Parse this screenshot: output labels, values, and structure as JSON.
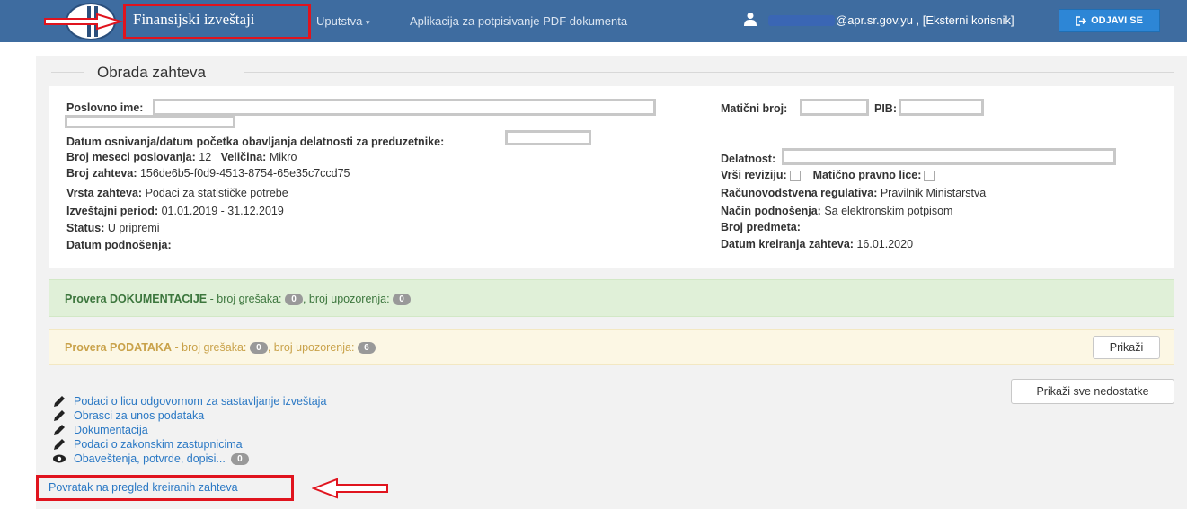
{
  "navbar": {
    "brand": "Finansijski izveštaji",
    "menu_uputstva": "Uputstva",
    "menu_aplikacija": "Aplikacija za potpisivanje PDF dokumenta",
    "user_text": "@apr.sr.gov.yu , [Eksterni korisnik]",
    "logout_label": "ODJAVI SE",
    "bg_color": "#3e6ca0",
    "logout_color": "#2d86d6"
  },
  "page": {
    "section_title": "Obrada zahteva"
  },
  "info": {
    "poslovno_ime_label": "Poslovno ime:",
    "maticni_broj_label": "Matični broj:",
    "pib_label": "PIB:",
    "datum_osnivanja_label": "Datum osnivanja/datum početka obavljanja delatnosti za preduzetnike:",
    "broj_meseci_label": "Broj meseci poslovanja:",
    "broj_meseci_value": "12",
    "velicina_label": "Veličina:",
    "velicina_value": "Mikro",
    "delatnost_label": "Delatnost:",
    "broj_zahteva_label": "Broj zahteva:",
    "broj_zahteva_value": "156de6b5-f0d9-4513-8754-65e35c7ccd75",
    "vrsi_reviziju_label": "Vrši reviziju:",
    "maticno_pravno_lice_label": "Matično pravno lice:",
    "vrsta_zahteva_label": "Vrsta zahteva:",
    "vrsta_zahteva_value": "Podaci za statističke potrebe",
    "racunovodstvena_label": "Računovodstvena regulativa:",
    "racunovodstvena_value": "Pravilnik Ministarstva",
    "izvestajni_period_label": "Izveštajni period:",
    "izvestajni_period_value": "01.01.2019 - 31.12.2019",
    "nacin_podnosenja_label": "Način podnošenja:",
    "nacin_podnosenja_value": "Sa elektronskim potpisom",
    "status_label": "Status:",
    "status_value": "U pripremi",
    "broj_predmeta_label": "Broj predmeta:",
    "datum_podnosenja_label": "Datum podnošenja:",
    "datum_kreiranja_label": "Datum kreiranja zahteva:",
    "datum_kreiranja_value": "16.01.2020"
  },
  "alerts": {
    "dokumentacija": {
      "title": "Provera DOKUMENTACIJE",
      "errors_text": " - broj grešaka: ",
      "errors_count": "0",
      "warnings_text": ", broj upozorenja: ",
      "warnings_count": "0",
      "color": "#3c763d"
    },
    "podataka": {
      "title": "Provera PODATAKA",
      "errors_text": " - broj grešaka: ",
      "errors_count": "0",
      "warnings_text": ", broj upozorenja: ",
      "warnings_count": "6",
      "color": "#c9a24a",
      "button_label": "Prikaži"
    }
  },
  "actions": {
    "show_all_label": "Prikaži sve nedostatke"
  },
  "links": [
    {
      "label": "Podaci o licu odgovornom za sastavljanje izveštaja",
      "icon": "pencil-icon"
    },
    {
      "label": "Obrasci za unos podataka",
      "icon": "pencil-icon"
    },
    {
      "label": "Dokumentacija",
      "icon": "pencil-icon"
    },
    {
      "label": "Podaci o zakonskim zastupnicima",
      "icon": "pencil-icon"
    },
    {
      "label": "Obaveštenja, potvrde, dopisi...",
      "icon": "eye-icon",
      "badge": "0"
    }
  ],
  "back_link": "Povratak na pregled kreiranih zahteva"
}
